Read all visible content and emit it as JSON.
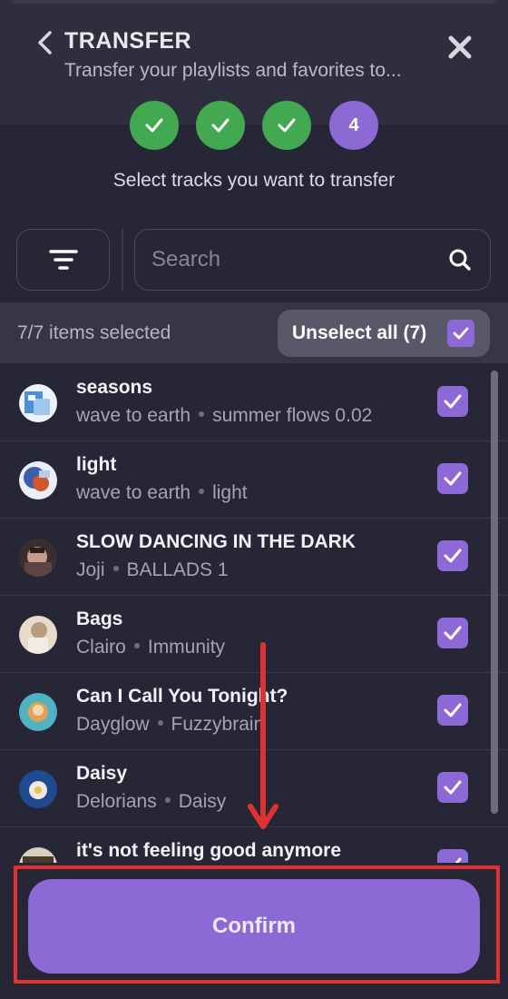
{
  "header": {
    "title": "TRANSFER",
    "subtitle": "Transfer your playlists and favorites to..."
  },
  "steps": [
    {
      "state": "done"
    },
    {
      "state": "done"
    },
    {
      "state": "done"
    },
    {
      "state": "active",
      "label": "4"
    }
  ],
  "instructions": "Select tracks you want to transfer",
  "search": {
    "placeholder": "Search",
    "value": ""
  },
  "selection": {
    "count_text": "7/7 items selected",
    "unselect_label": "Unselect all (7)"
  },
  "tracks": [
    {
      "name": "seasons",
      "artist": "wave to earth",
      "album": "summer flows 0.02",
      "selected": true
    },
    {
      "name": "light",
      "artist": "wave to earth",
      "album": "light",
      "selected": true
    },
    {
      "name": "SLOW DANCING IN THE DARK",
      "artist": "Joji",
      "album": "BALLADS 1",
      "selected": true
    },
    {
      "name": "Bags",
      "artist": "Clairo",
      "album": "Immunity",
      "selected": true
    },
    {
      "name": "Can I Call You Tonight?",
      "artist": "Dayglow",
      "album": "Fuzzybrain",
      "selected": true
    },
    {
      "name": "Daisy",
      "artist": "Delorians",
      "album": "Daisy",
      "selected": true
    },
    {
      "name": "it's not feeling good anymore",
      "artist": "",
      "album": "",
      "selected": true
    }
  ],
  "confirm_label": "Confirm",
  "colors": {
    "background": "#262636",
    "header": "#2e2e3f",
    "accent_purple": "#8d69d6",
    "step_done_green": "#43a951",
    "highlight_red": "#e03131"
  },
  "icons": {
    "back": "chevron-left-icon",
    "close": "close-icon",
    "filter": "filter-icon",
    "search": "search-icon",
    "check": "check-icon"
  }
}
